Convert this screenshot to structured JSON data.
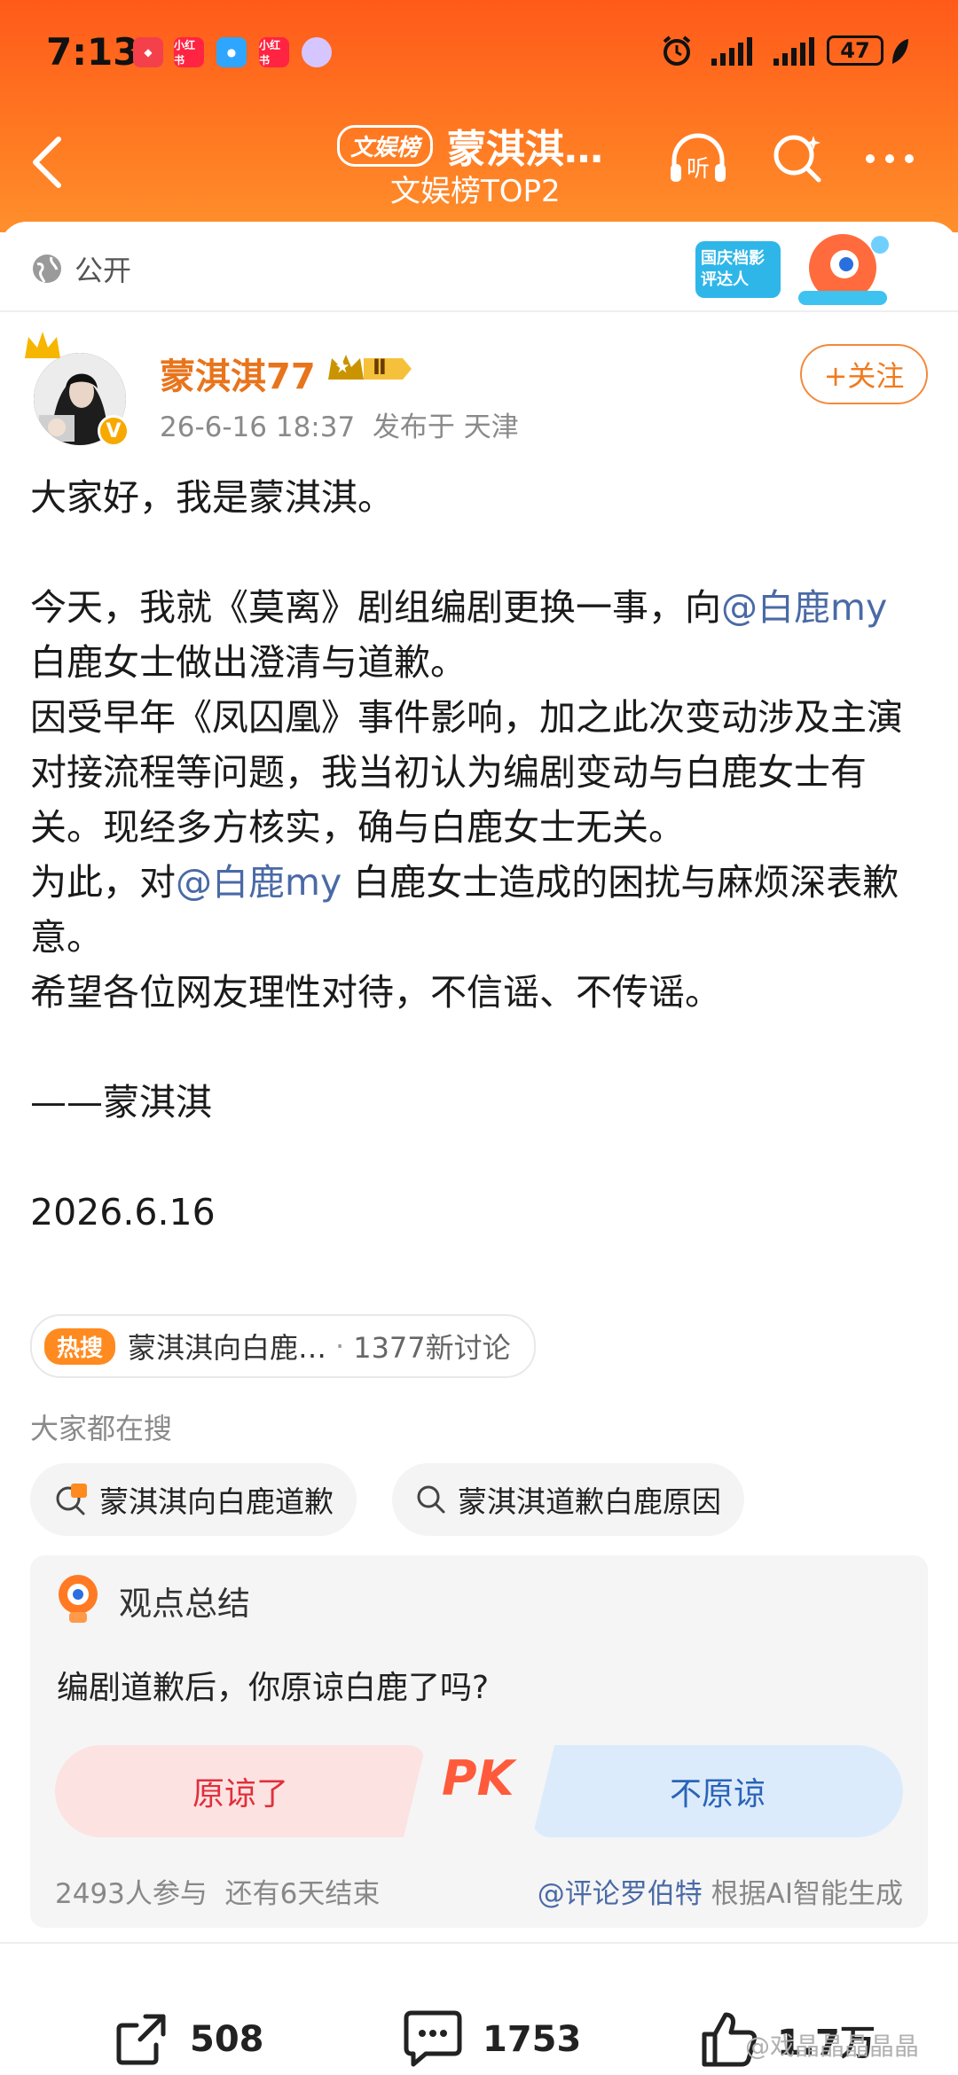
{
  "status_bar": {
    "time": "7:13",
    "apps": [
      "小红书",
      "小红书"
    ],
    "signal1": "1",
    "battery": "47"
  },
  "nav": {
    "badge": "文娱榜",
    "title": "蒙淇淇…",
    "subtitle": "文娱榜TOP2",
    "listen_label": "听"
  },
  "post_meta": {
    "visibility": "公开",
    "promo_text": "国庆档影评达人"
  },
  "author": {
    "name": "蒙淇淇77",
    "level": "Ⅱ",
    "verified": "V",
    "date": "26-6-16 18:37",
    "location": "发布于 天津",
    "follow_label": "+关注"
  },
  "post": {
    "line1": "大家好，我是蒙淇淇。",
    "p2a": "今天，我就《莫离》剧组编剧更换一事，向",
    "mention1": "@白鹿my",
    "p2b": " 白鹿女士做出澄清与道歉。",
    "p3": "因受早年《凤囚凰》事件影响，加之此次变动涉及主演对接流程等问题，我当初认为编剧变动与白鹿女士有关。现经多方核实，确与白鹿女士无关。",
    "p4a": "为此，对",
    "mention2": "@白鹿my",
    "p4b": " 白鹿女士造成的困扰与麻烦深表歉意。",
    "p5": "希望各位网友理性对待，不信谣、不传谣。",
    "signature": "——蒙淇淇",
    "date": "2026.6.16"
  },
  "hot_search": {
    "tag": "热搜",
    "topic": "蒙淇淇向白鹿…",
    "dot": "·",
    "count": "1377新讨论"
  },
  "related": {
    "title": "大家都在搜",
    "chips": [
      "蒙淇淇向白鹿道歉",
      "蒙淇淇道歉白鹿原因"
    ]
  },
  "summary": {
    "title": "观点总结",
    "question": "编剧道歉后，你原谅白鹿了吗?",
    "option_left": "原谅了",
    "pk": "PK",
    "option_right": "不原谅",
    "participants": "2493人参与",
    "remaining": "还有6天结束",
    "author": "@评论罗伯特",
    "generated": " 根据AI智能生成"
  },
  "actions": {
    "share": "508",
    "comment": "1753",
    "like": "1.7万"
  },
  "watermark": "@戏晶晶晶晶晶",
  "colors": {
    "header": "#ff6a1f",
    "username": "#e8741c",
    "mention": "#4a6aa6",
    "pk_left": "#e0303a",
    "pk_right": "#2a64b8"
  }
}
